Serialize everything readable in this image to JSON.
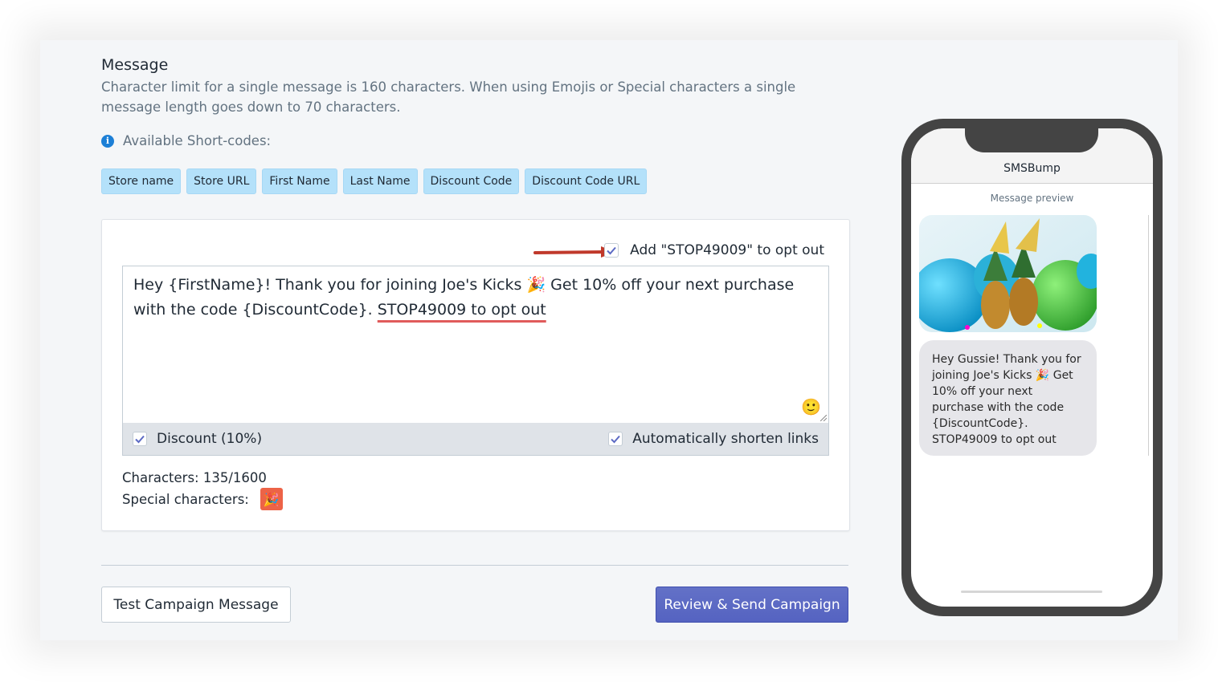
{
  "message": {
    "title": "Message",
    "description": "Character limit for a single message is 160 characters. When using Emojis or Special characters a single message length goes down to 70 characters.",
    "shortcodes_label": "Available Short-codes:",
    "shortcodes": [
      "Store name",
      "Store URL",
      "First Name",
      "Last Name",
      "Discount Code",
      "Discount Code URL"
    ]
  },
  "editor": {
    "optout_label": "Add \"STOP49009\" to opt out",
    "optout_checked": true,
    "text_main": "Hey {FirstName}! Thank you for joining Joe's Kicks 🎉 Get 10% off your next purchase with the code {DiscountCode}. ",
    "text_optout": "STOP49009 to opt out",
    "emoji_icon": "🙂",
    "discount_label": "Discount (10%)",
    "shorten_label": "Automatically shorten links",
    "char_count": "Characters: 135/1600",
    "special_label": "Special characters:",
    "special_char": "🎉"
  },
  "actions": {
    "test_label": "Test Campaign Message",
    "send_label": "Review & Send Campaign"
  },
  "phone": {
    "app_name": "SMSBump",
    "preview_label": "Message preview",
    "preview_text": "Hey Gussie! Thank you for joining Joe's Kicks 🎉 Get 10% off your next purchase with the code {DiscountCode}. STOP49009 to opt out"
  },
  "colors": {
    "accent": "#5c6ac4",
    "chip": "#b4e1fa",
    "arrow": "#c0392b",
    "underline": "#e05b5b",
    "special_badge": "#ed6347"
  }
}
